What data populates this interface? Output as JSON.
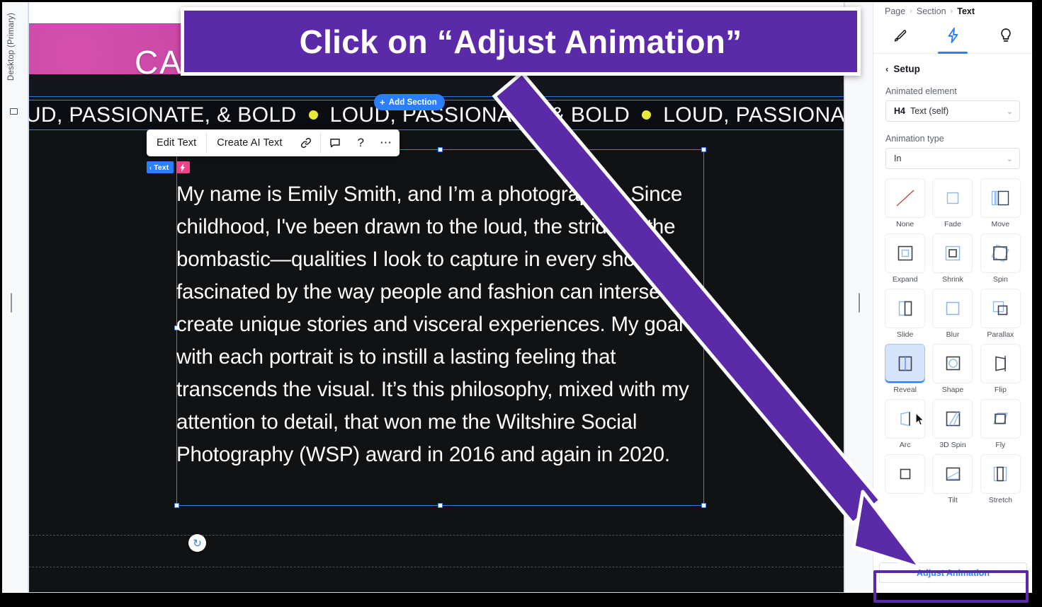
{
  "annotation": {
    "banner_text": "Click on “Adjust Animation”",
    "banner_color": "#5B2AA8",
    "arrow_color": "#5B2AA8"
  },
  "left_rail": {
    "breakpoint_label": "Desktop (Primary)",
    "breakpoint_icon": "monitor-icon",
    "resize_handle": "left-canvas-resize-handle"
  },
  "canvas": {
    "hero": {
      "word": "CAIN"
    },
    "add_section_button": {
      "label": "Add Section",
      "icon": "plus-icon"
    },
    "marquee": {
      "items": [
        "LOUD, PASSIONATE, & BOLD",
        "LOUD, PASSIONATE, & BOLD",
        "LOUD, PASSIONATE, &"
      ],
      "separator_icon": "yellow-star-dot"
    },
    "element_toolbar": {
      "edit_text": "Edit Text",
      "create_ai_text": "Create AI Text",
      "link_icon": "link-icon",
      "comment_icon": "comment-icon",
      "help_icon": "question-mark-icon",
      "more_icon": "ellipsis-icon"
    },
    "element_badge": {
      "label": "Text",
      "back_chevron": "‹",
      "bolt_icon": "lightning-bolt-icon"
    },
    "body_text": "My name is Emily Smith, and I’m a photographer. Since childhood, I've been drawn to the loud, the strident, the bombastic—qualities I look to capture in every shot. I’m fascinated by the way people and fashion can intersect to create unique stories and visceral experiences. My goal with each portrait is to instill a lasting feeling that transcends the visual. It’s this philosophy, mixed with my attention to detail, that won me the Wiltshire Social Photography (WSP) award in 2016 and again in 2020.",
    "rotate_handle_icon": "rotate-icon"
  },
  "right_gutter": {
    "expand_chevron": "›",
    "resize_handle": "right-canvas-resize-handle"
  },
  "panel": {
    "breadcrumb": {
      "items": [
        "Page",
        "Section",
        "Text"
      ],
      "separator": "›"
    },
    "tabs": [
      {
        "name": "style-tab",
        "icon": "paintbrush-icon",
        "active": false
      },
      {
        "name": "interactions-tab",
        "icon": "lightning-bolt-icon",
        "active": true
      },
      {
        "name": "ideas-tab",
        "icon": "lightbulb-icon",
        "active": false
      }
    ],
    "setup": {
      "back_chevron": "‹",
      "title": "Setup"
    },
    "animated_element": {
      "label": "Animated element",
      "tag": "H4",
      "value": "Text (self)",
      "caret": "⌄"
    },
    "animation_type": {
      "label": "Animation type",
      "value": "In",
      "caret": "⌄"
    },
    "animations": [
      {
        "label": "None",
        "icon": "diagonal-line-icon",
        "selected": false
      },
      {
        "label": "Fade",
        "icon": "square-outline-icon",
        "selected": false
      },
      {
        "label": "Move",
        "icon": "move-bars-icon",
        "selected": false
      },
      {
        "label": "Expand",
        "icon": "nested-square-icon",
        "selected": false
      },
      {
        "label": "Shrink",
        "icon": "shrink-square-icon",
        "selected": false
      },
      {
        "label": "Spin",
        "icon": "rotated-square-icon",
        "selected": false
      },
      {
        "label": "Slide",
        "icon": "split-panel-icon",
        "selected": false
      },
      {
        "label": "Blur",
        "icon": "blurred-square-icon",
        "selected": false
      },
      {
        "label": "Parallax",
        "icon": "offset-squares-icon",
        "selected": false
      },
      {
        "label": "Reveal",
        "icon": "reveal-panel-icon",
        "selected": true
      },
      {
        "label": "Shape",
        "icon": "circle-in-square-icon",
        "selected": false
      },
      {
        "label": "Flip",
        "icon": "flip-panel-icon",
        "selected": false
      },
      {
        "label": "Arc",
        "icon": "arc-panel-icon",
        "selected": false
      },
      {
        "label": "3D Spin",
        "icon": "3d-spin-icon",
        "selected": false
      },
      {
        "label": "Fly",
        "icon": "fly-skew-icon",
        "selected": false
      },
      {
        "label": "",
        "icon": "grow-square-icon",
        "selected": false
      },
      {
        "label": "Tilt",
        "icon": "tilt-square-icon",
        "selected": false
      },
      {
        "label": "Stretch",
        "icon": "stretch-bars-icon",
        "selected": false
      }
    ],
    "adjust_animation_button": "Adjust Animation",
    "cursor_icon": "mouse-pointer-icon"
  }
}
